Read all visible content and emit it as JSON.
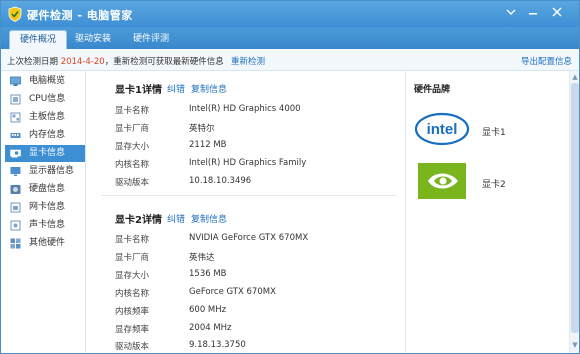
{
  "window": {
    "title": "硬件检测 - 电脑管家",
    "menu_icon": "menu-icon",
    "minimize_icon": "minimize-icon",
    "close_icon": "close-icon"
  },
  "tabs": [
    {
      "label": "硬件概况"
    },
    {
      "label": "驱动安装"
    },
    {
      "label": "硬件评测"
    }
  ],
  "infobar": {
    "prefix": "上次检测日期 ",
    "date": "2014-4-20",
    "suffix": "，重新检测可获取最新硬件信息",
    "recheck_link": "重新检测",
    "export_link": "导出配置信息"
  },
  "sidebar": {
    "items": [
      {
        "label": "电脑概览",
        "icon": "computer-icon"
      },
      {
        "label": "CPU信息",
        "icon": "cpu-icon"
      },
      {
        "label": "主板信息",
        "icon": "motherboard-icon"
      },
      {
        "label": "内存信息",
        "icon": "memory-icon"
      },
      {
        "label": "显卡信息",
        "icon": "graphics-card-icon"
      },
      {
        "label": "显示器信息",
        "icon": "monitor-icon"
      },
      {
        "label": "硬盘信息",
        "icon": "hard-disk-icon"
      },
      {
        "label": "网卡信息",
        "icon": "network-card-icon"
      },
      {
        "label": "声卡信息",
        "icon": "sound-card-icon"
      },
      {
        "label": "其他硬件",
        "icon": "other-hardware-icon"
      }
    ],
    "active_index": 4
  },
  "gpu1": {
    "title": "显卡1详情",
    "link_fix": "纠错",
    "link_copy": "复制信息",
    "rows": [
      {
        "label": "显卡名称",
        "value": "Intel(R) HD Graphics 4000"
      },
      {
        "label": "显卡厂商",
        "value": "英特尔"
      },
      {
        "label": "显存大小",
        "value": "2112 MB"
      },
      {
        "label": "内核名称",
        "value": "Intel(R) HD Graphics Family"
      },
      {
        "label": "驱动版本",
        "value": "10.18.10.3496"
      }
    ]
  },
  "gpu2": {
    "title": "显卡2详情",
    "link_fix": "纠错",
    "link_copy": "复制信息",
    "rows": [
      {
        "label": "显卡名称",
        "value": "NVIDIA GeForce GTX 670MX"
      },
      {
        "label": "显卡厂商",
        "value": "英伟达"
      },
      {
        "label": "显存大小",
        "value": "1536 MB"
      },
      {
        "label": "内核名称",
        "value": "GeForce GTX 670MX"
      },
      {
        "label": "内核频率",
        "value": "600 MHz"
      },
      {
        "label": "显存频率",
        "value": "2004 MHz"
      },
      {
        "label": "驱动版本",
        "value": "9.18.13.3750"
      }
    ]
  },
  "brands": {
    "title": "硬件品牌",
    "items": [
      {
        "label": "显卡1",
        "logo": "intel-logo",
        "logo_text": "intel"
      },
      {
        "label": "显卡2",
        "logo": "nvidia-logo"
      }
    ]
  },
  "colors": {
    "accent": "#3d8fd4",
    "link": "#1e6fc2",
    "date": "#e04020"
  }
}
